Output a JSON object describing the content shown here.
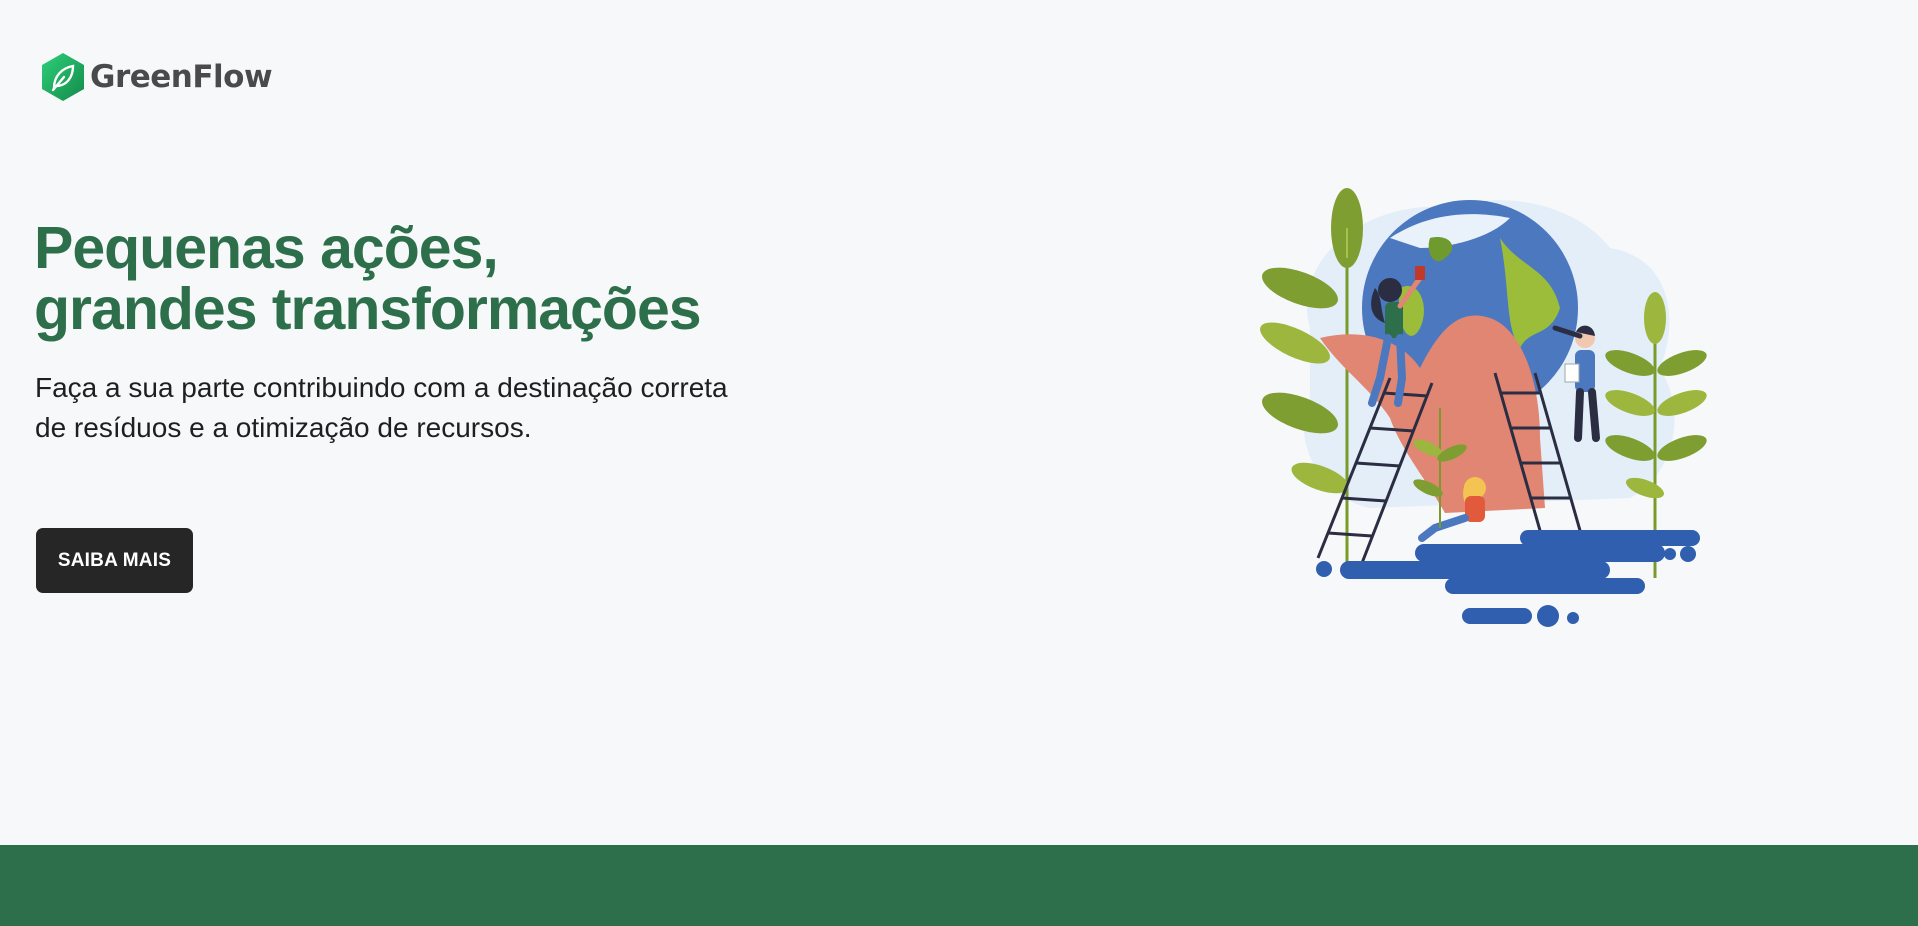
{
  "brand": {
    "name": "GreenFlow",
    "logo_icon": "leaf-hexagon-icon",
    "color_primary": "#2e6f4b",
    "color_logo_gradient_start": "#2ecf7a",
    "color_logo_gradient_end": "#138a4a"
  },
  "hero": {
    "title_line1": "Pequenas ações,",
    "title_line2": "grandes transformações",
    "subtitle_line1": "Faça a sua parte contribuindo com a destinação correta",
    "subtitle_line2": "de resíduos e a otimização de recursos.",
    "cta_label": "SAIBA MAIS"
  },
  "illustration": {
    "icon": "globe-hand-plants-illustration"
  },
  "footer": {
    "color": "#2e6f4b"
  }
}
